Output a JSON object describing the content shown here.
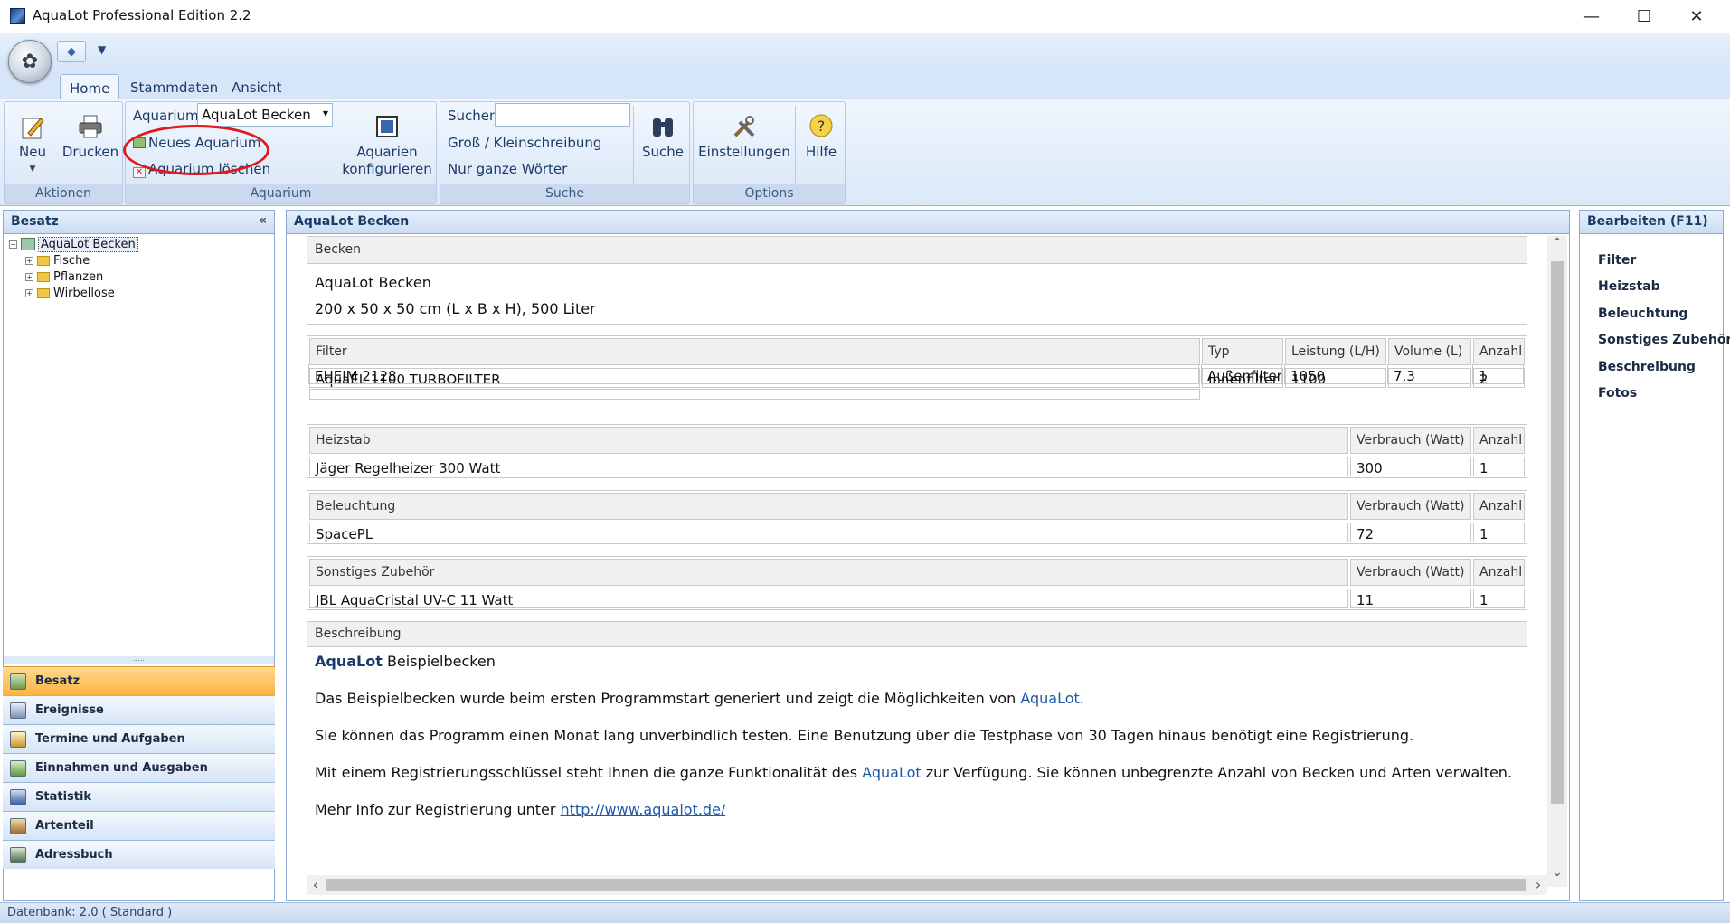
{
  "window": {
    "title": "AquaLot Professional Edition 2.2"
  },
  "tabs": [
    {
      "label": "Home"
    },
    {
      "label": "Stammdaten"
    },
    {
      "label": "Ansicht"
    }
  ],
  "ribbon": {
    "aktionen": {
      "caption": "Aktionen",
      "neu": "Neu",
      "drucken": "Drucken"
    },
    "aquarium": {
      "caption": "Aquarium",
      "label": "Aquarium",
      "selected": "AquaLot Becken",
      "neues": "Neues Aquarium",
      "loeschen": "Aquarium löschen",
      "konfigurieren_1": "Aquarien",
      "konfigurieren_2": "konfigurieren"
    },
    "suche": {
      "caption": "Suche",
      "label": "Suchen",
      "gross": "Groß / Kleinschreibung",
      "ganze": "Nur ganze Wörter",
      "button": "Suche"
    },
    "options": {
      "caption": "Options",
      "einstellungen": "Einstellungen",
      "hilfe": "Hilfe"
    }
  },
  "left": {
    "header": "Besatz",
    "collapse": "«",
    "tree": {
      "root": "AquaLot Becken",
      "children": [
        "Fische",
        "Pflanzen",
        "Wirbellose"
      ]
    },
    "nav": [
      "Besatz",
      "Ereignisse",
      "Termine und Aufgaben",
      "Einnahmen und Ausgaben",
      "Statistik",
      "Artenteil",
      "Adressbuch"
    ]
  },
  "main": {
    "header": "AquaLot Becken",
    "becken": {
      "title": "Becken",
      "name": "AquaLot Becken",
      "size": "200 x 50 x 50 cm (L x B x H), 500 Liter"
    },
    "filter": {
      "headers": [
        "Filter",
        "Typ",
        "Leistung (L/H)",
        "Volume (L)",
        "Anzahl"
      ],
      "rows": [
        [
          "AquaEL 1100 TURBOFILTER",
          "Innenfilter",
          "1100",
          "",
          "2"
        ],
        [
          "EHEIM 2128",
          "Außenfilter",
          "1050",
          "7,3",
          "1"
        ]
      ]
    },
    "heizstab": {
      "headers": [
        "Heizstab",
        "Verbrauch (Watt)",
        "Anzahl"
      ],
      "row": [
        "Jäger Regelheizer 300 Watt",
        "300",
        "1"
      ]
    },
    "beleuchtung": {
      "headers": [
        "Beleuchtung",
        "Verbrauch (Watt)",
        "Anzahl"
      ],
      "row": [
        "SpacePL",
        "72",
        "1"
      ]
    },
    "zubehoer": {
      "headers": [
        "Sonstiges Zubehör",
        "Verbrauch (Watt)",
        "Anzahl"
      ],
      "row": [
        "JBL AquaCristal UV-C 11 Watt",
        "11",
        "1"
      ]
    },
    "beschreibung": {
      "title": "Beschreibung",
      "brand": "AquaLot",
      "heading_rest": " Beispielbecken",
      "p1_a": "Das Beispielbecken wurde beim ersten Programmstart generiert und zeigt die Möglichkeiten von ",
      "p1_link": "AquaLot",
      "p1_b": ".",
      "p2": "Sie können das Programm einen Monat lang unverbindlich testen. Eine Benutzung über die Testphase von 30 Tagen hinaus benötigt eine Registrierung.",
      "p3_a": "Mit einem Registrierungsschlüssel steht Ihnen die ganze Funktionalität des ",
      "p3_link": "AquaLot",
      "p3_b": " zur Verfügung. Sie können unbegrenzte Anzahl von Becken und Arten verwalten.",
      "p4_a": "Mehr Info zur Registrierung unter ",
      "p4_link": "http://www.aqualot.de/"
    }
  },
  "right": {
    "header": "Bearbeiten (F11)",
    "items": [
      "Filter",
      "Heizstab",
      "Beleuchtung",
      "Sonstiges Zubehör",
      "Beschreibung",
      "Fotos"
    ]
  },
  "status": {
    "text": "Datenbank: 2.0 ( Standard )"
  }
}
